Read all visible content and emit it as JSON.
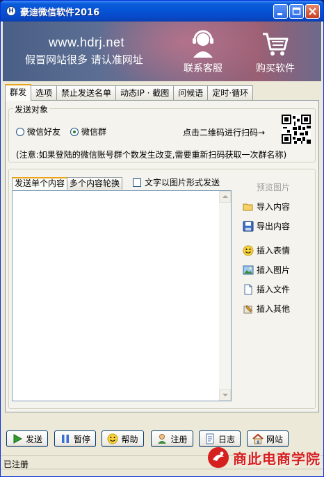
{
  "window": {
    "title": "豪迪微信软件2016",
    "icon_letter": "H"
  },
  "banner": {
    "url": "www.hdrj.net",
    "tagline": "假冒网站很多 请认准网址",
    "support_label": "联系客服",
    "buy_label": "购买软件"
  },
  "tabs": [
    {
      "label": "群发",
      "active": true
    },
    {
      "label": "选项"
    },
    {
      "label": "禁止发送名单"
    },
    {
      "label": "动态IP · 截图"
    },
    {
      "label": "问候语"
    },
    {
      "label": "定时·循环"
    }
  ],
  "target": {
    "group_title": "发送对象",
    "radio_friends": "微信好友",
    "radio_groups": "微信群",
    "selected": "微信群",
    "qr_hint": "点击二维码进行扫码→",
    "notice": "(注意:如果登陆的微信账号群个数发生改变,需要重新扫码获取一次群名称)"
  },
  "content": {
    "tab_single": "发送单个内容",
    "tab_multi": "多个内容轮换",
    "checkbox_label": "文字以图片形式发送",
    "textarea_value": "",
    "side": {
      "preview": "预览图片",
      "import": "导入内容",
      "export": "导出内容",
      "insert_emoji": "插入表情",
      "insert_image": "插入图片",
      "insert_file": "插入文件",
      "insert_other": "插入其他"
    }
  },
  "buttons": {
    "send": "发送",
    "pause": "暂停",
    "help": "帮助",
    "register": "注册",
    "log": "日志",
    "website": "网站"
  },
  "status": {
    "text": "已注册"
  },
  "watermark": {
    "text": "商此电商学院"
  },
  "colors": {
    "titlebar": "#0653d6",
    "tab_highlight": "#e8a41a",
    "watermark_red": "#d61f1f"
  }
}
